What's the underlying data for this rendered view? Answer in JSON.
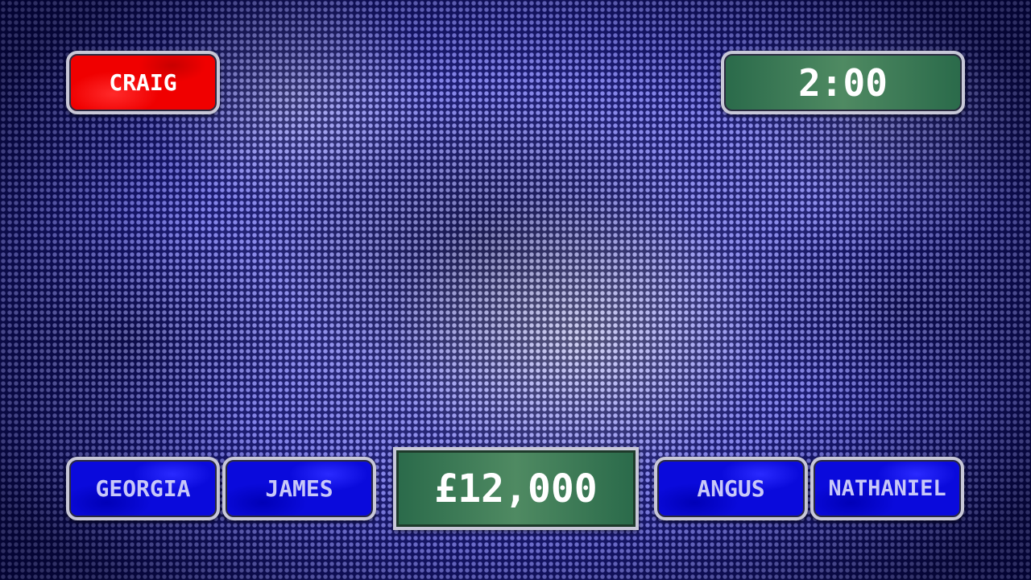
{
  "active_player": {
    "name": "CRAIG",
    "color": "#f00000"
  },
  "timer": {
    "value": "2:00"
  },
  "prize": {
    "amount": "£12,000"
  },
  "players": [
    {
      "name": "GEORGIA"
    },
    {
      "name": "JAMES"
    },
    {
      "name": "ANGUS"
    },
    {
      "name": "NATHANIEL"
    }
  ],
  "colors": {
    "player_panel": "#0a0adc",
    "player_text": "#c8c8f8",
    "timer_panel": "#3e7a56",
    "prize_panel": "#3e7a56",
    "background": "#3535d8"
  }
}
